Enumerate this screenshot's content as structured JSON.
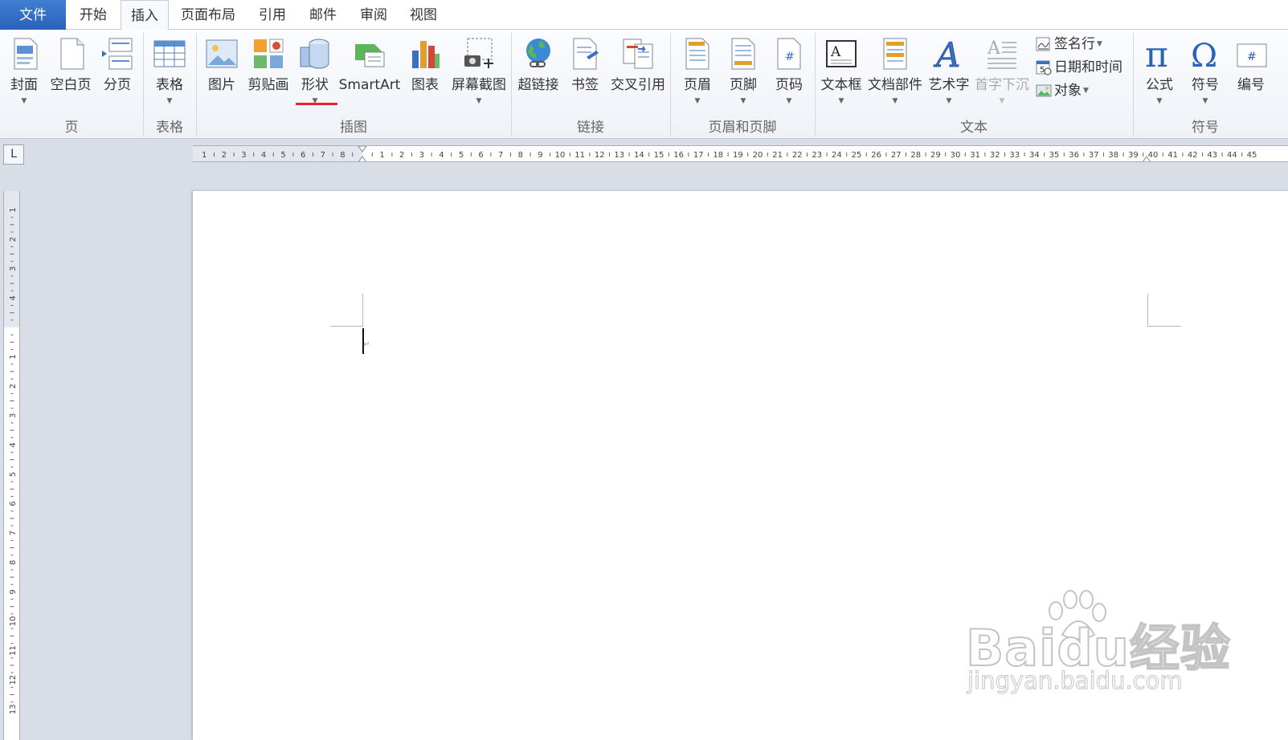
{
  "tabs": {
    "file": "文件",
    "home": "开始",
    "insert": "插入",
    "layout": "页面布局",
    "references": "引用",
    "mailings": "邮件",
    "review": "审阅",
    "view": "视图",
    "active": "insert"
  },
  "ribbon": {
    "pages": {
      "cover": "封面",
      "blank": "空白页",
      "break": "分页",
      "group": "页"
    },
    "tables": {
      "table": "表格",
      "group": "表格"
    },
    "illustrations": {
      "picture": "图片",
      "clipart": "剪贴画",
      "shapes": "形状",
      "smartart": "SmartArt",
      "chart": "图表",
      "screenshot": "屏幕截图",
      "group": "插图"
    },
    "links": {
      "hyperlink": "超链接",
      "bookmark": "书签",
      "crossref": "交叉引用",
      "group": "链接"
    },
    "header_footer": {
      "header": "页眉",
      "footer": "页脚",
      "page_number": "页码",
      "group": "页眉和页脚"
    },
    "text": {
      "textbox": "文本框",
      "quickparts": "文档部件",
      "wordart": "艺术字",
      "dropcap": "首字下沉",
      "signature": "签名行",
      "datetime": "日期和时间",
      "object": "对象",
      "group": "文本"
    },
    "symbols": {
      "equation": "公式",
      "symbol": "符号",
      "numbering": "编号",
      "group": "符号"
    }
  },
  "ruler": {
    "corner": "L",
    "horizontal_left": [
      "8",
      "7",
      "6",
      "5",
      "4",
      "3",
      "2",
      "1"
    ],
    "horizontal_right": [
      "1",
      "2",
      "3",
      "4",
      "5",
      "6",
      "7",
      "8",
      "9",
      "10",
      "11",
      "12",
      "13",
      "14",
      "15",
      "16",
      "17",
      "18",
      "19",
      "20",
      "21",
      "22",
      "23",
      "24",
      "25",
      "26",
      "27",
      "28",
      "29",
      "30",
      "31",
      "32",
      "33",
      "34",
      "35",
      "36",
      "37",
      "38",
      "39",
      "40",
      "41",
      "42",
      "43",
      "44",
      "45"
    ],
    "vertical_top": [
      "4",
      "3",
      "2",
      "1"
    ],
    "vertical_bottom": [
      "1",
      "2",
      "3",
      "4",
      "5",
      "6",
      "7",
      "8",
      "9",
      "10",
      "11",
      "12",
      "13"
    ]
  },
  "watermark": {
    "brand": "Bai",
    "brand2": "du",
    "product": "经验",
    "url": "jingyan.baidu.com"
  },
  "colors": {
    "file_tab": "#2a62b8",
    "highlight": "#e8232a",
    "ribbon_bg": "#eef2f7",
    "workspace": "#d8dde6"
  },
  "icons": {
    "cover": "cover-page-icon",
    "blank": "blank-page-icon",
    "break": "page-break-icon",
    "table": "table-grid-icon",
    "picture": "picture-icon",
    "clipart": "clipart-icon",
    "shapes": "shapes-icon",
    "smartart": "smartart-icon",
    "chart": "bar-chart-icon",
    "screenshot": "screenshot-icon",
    "hyperlink": "globe-link-icon",
    "bookmark": "bookmark-icon",
    "crossref": "cross-reference-icon",
    "header": "header-icon",
    "footer": "footer-icon",
    "page_number": "page-number-icon",
    "textbox": "text-box-icon",
    "quickparts": "quick-parts-icon",
    "wordart": "word-art-icon",
    "dropcap": "drop-cap-icon",
    "signature": "signature-line-icon",
    "datetime": "date-time-icon",
    "object": "object-icon",
    "equation": "pi-icon",
    "symbol": "omega-icon",
    "numbering": "numbering-icon"
  }
}
